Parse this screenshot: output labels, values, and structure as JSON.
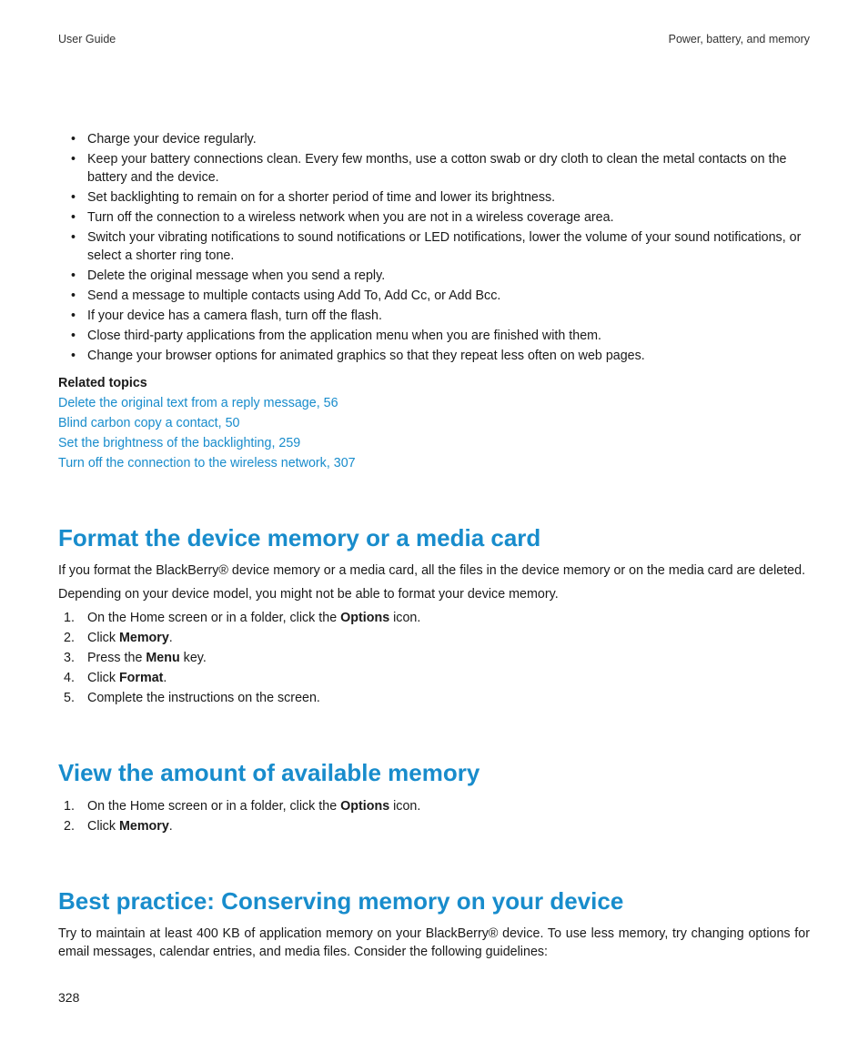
{
  "header": {
    "left": "User Guide",
    "right": "Power, battery, and memory"
  },
  "battery_tips": [
    "Charge your device regularly.",
    "Keep your battery connections clean. Every few months, use a cotton swab or dry cloth to clean the metal contacts on the battery and the device.",
    "Set backlighting to remain on for a shorter period of time and lower its brightness.",
    "Turn off the connection to a wireless network when you are not in a wireless coverage area.",
    "Switch your vibrating notifications to sound notifications or LED notifications, lower the volume of your sound notifications, or select a shorter ring tone.",
    "Delete the original message when you send a reply.",
    "Send a message to multiple contacts using Add To, Add Cc, or Add Bcc.",
    "If your device has a camera flash, turn off the flash.",
    "Close third-party applications from the application menu when you are finished with them.",
    "Change your browser options for animated graphics so that they repeat less often on web pages."
  ],
  "related": {
    "heading": "Related topics",
    "links": [
      "Delete the original text from a reply message, 56",
      "Blind carbon copy a contact, 50",
      "Set the brightness of the backlighting, 259",
      "Turn off the connection to the wireless network, 307"
    ]
  },
  "section_format": {
    "title": "Format the device memory or a media card",
    "p1": "If you format the BlackBerry® device memory or a media card, all the files in the device memory or on the media card are deleted.",
    "p2": "Depending on your device model, you might not be able to format your device memory.",
    "steps": {
      "s1a": "On the Home screen or in a folder, click the ",
      "s1b": "Options",
      "s1c": " icon.",
      "s2a": "Click ",
      "s2b": "Memory",
      "s2c": ".",
      "s3a": "Press the ",
      "s3b": "Menu",
      "s3c": " key.",
      "s4a": "Click ",
      "s4b": "Format",
      "s4c": ".",
      "s5": "Complete the instructions on the screen."
    }
  },
  "section_view": {
    "title": "View the amount of available memory",
    "steps": {
      "s1a": "On the Home screen or in a folder, click the ",
      "s1b": "Options",
      "s1c": " icon.",
      "s2a": "Click ",
      "s2b": "Memory",
      "s2c": "."
    }
  },
  "section_best": {
    "title": "Best practice: Conserving memory on your device",
    "p1": "Try to maintain at least 400 KB of application memory on your BlackBerry® device. To use less memory, try changing options for email messages, calendar entries, and media files. Consider the following guidelines:"
  },
  "page_number": "328"
}
